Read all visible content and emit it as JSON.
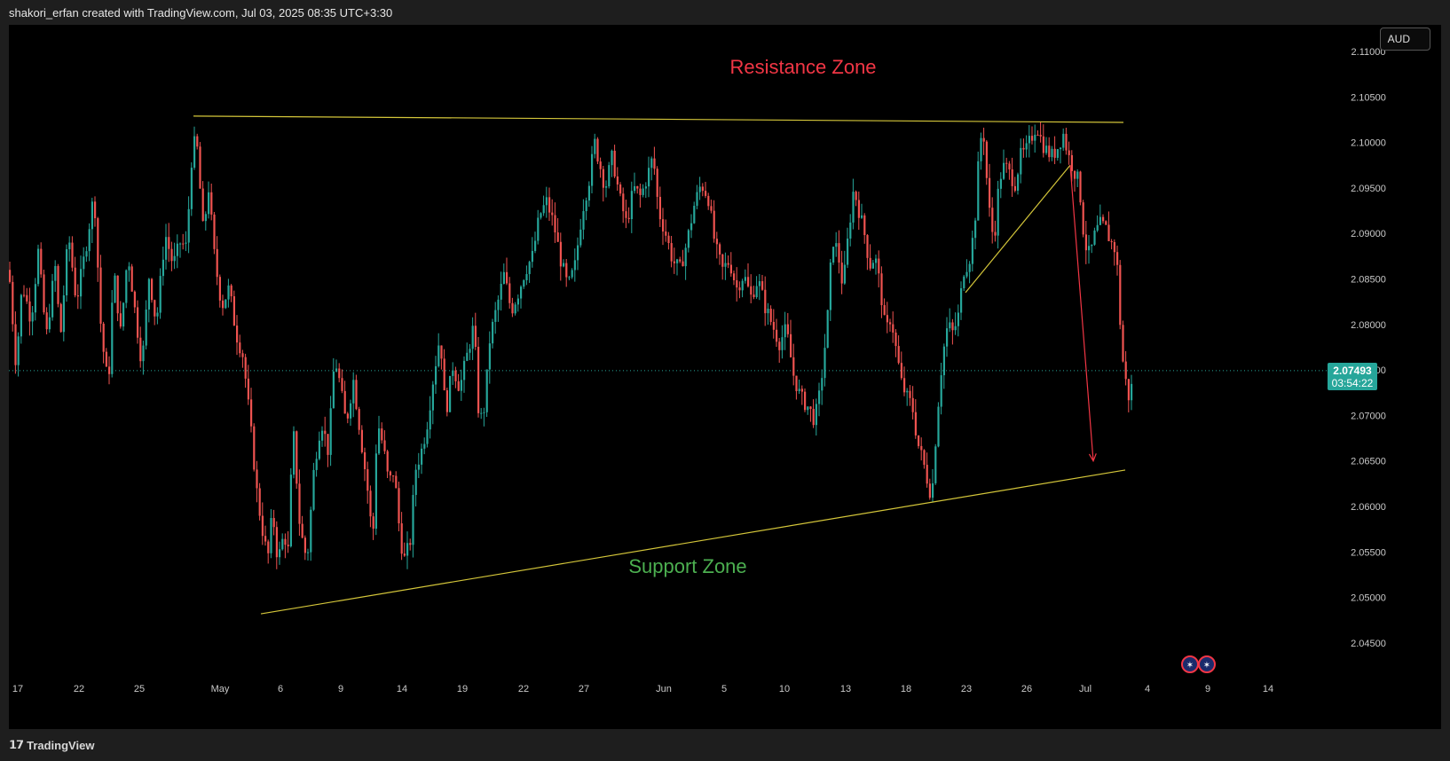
{
  "header": {
    "attribution": "shakori_erfan created with TradingView.com, Jul 03, 2025 08:35 UTC+3:30"
  },
  "footer": {
    "brand": "TradingView",
    "brand_icon": "tradingview-logo-icon"
  },
  "currency_button": "AUD",
  "colors": {
    "background": "#000000",
    "up_candle": "#26a69a",
    "down_candle": "#ef5350",
    "trendline": "#d4c63a",
    "arrow": "#f23645",
    "resistance_text": "#f23645",
    "support_text": "#4caf50",
    "price_tag": "#26a69a"
  },
  "chart_data": {
    "type": "candlestick",
    "instrument_quote": "AUD",
    "y_ticks": [
      "2.11000",
      "2.10500",
      "2.10000",
      "2.09500",
      "2.09000",
      "2.08500",
      "2.08000",
      "2.07500",
      "2.07000",
      "2.06500",
      "2.06000",
      "2.05500",
      "2.05000",
      "2.04500"
    ],
    "ylim": [
      2.0418,
      2.1143
    ],
    "x_ticks": [
      "17",
      "22",
      "25",
      "May",
      "6",
      "9",
      "14",
      "19",
      "22",
      "27",
      "Jun",
      "5",
      "10",
      "13",
      "18",
      "23",
      "26",
      "Jul",
      "4",
      "9",
      "14"
    ],
    "current_price": "2.07493",
    "countdown": "03:54:22",
    "annotations": {
      "resistance_label": "Resistance Zone",
      "support_label": "Support Zone"
    },
    "price_path": [
      [
        0,
        2.086
      ],
      [
        8,
        2.0755
      ],
      [
        15,
        2.0845
      ],
      [
        25,
        2.0805
      ],
      [
        33,
        2.088
      ],
      [
        42,
        2.0785
      ],
      [
        52,
        2.0865
      ],
      [
        58,
        2.0785
      ],
      [
        67,
        2.09
      ],
      [
        76,
        2.0825
      ],
      [
        86,
        2.088
      ],
      [
        96,
        2.0945
      ],
      [
        104,
        2.079
      ],
      [
        112,
        2.073
      ],
      [
        118,
        2.086
      ],
      [
        126,
        2.079
      ],
      [
        134,
        2.088
      ],
      [
        142,
        2.0815
      ],
      [
        150,
        2.0755
      ],
      [
        158,
        2.0855
      ],
      [
        166,
        2.08
      ],
      [
        176,
        2.09
      ],
      [
        185,
        2.0865
      ],
      [
        193,
        2.089
      ],
      [
        200,
        2.0885
      ],
      [
        207,
        2.1
      ],
      [
        212,
        2.0995
      ],
      [
        219,
        2.09
      ],
      [
        225,
        2.095
      ],
      [
        232,
        2.087
      ],
      [
        240,
        2.082
      ],
      [
        248,
        2.084
      ],
      [
        256,
        2.079
      ],
      [
        264,
        2.0765
      ],
      [
        272,
        2.069
      ],
      [
        280,
        2.061
      ],
      [
        288,
        2.056
      ],
      [
        292,
        2.0545
      ],
      [
        297,
        2.0595
      ],
      [
        303,
        2.054
      ],
      [
        310,
        2.057
      ],
      [
        315,
        2.055
      ],
      [
        320,
        2.069
      ],
      [
        328,
        2.0575
      ],
      [
        336,
        2.054
      ],
      [
        344,
        2.0645
      ],
      [
        352,
        2.0695
      ],
      [
        360,
        2.066
      ],
      [
        367,
        2.0765
      ],
      [
        372,
        2.074
      ],
      [
        380,
        2.069
      ],
      [
        388,
        2.074
      ],
      [
        396,
        2.068
      ],
      [
        404,
        2.062
      ],
      [
        410,
        2.056
      ],
      [
        415,
        2.0695
      ],
      [
        422,
        2.0665
      ],
      [
        428,
        2.0625
      ],
      [
        434,
        2.064
      ],
      [
        440,
        2.0575
      ],
      [
        445,
        2.054
      ],
      [
        452,
        2.056
      ],
      [
        458,
        2.064
      ],
      [
        466,
        2.0665
      ],
      [
        472,
        2.0695
      ],
      [
        478,
        2.074
      ],
      [
        486,
        2.079
      ],
      [
        492,
        2.07
      ],
      [
        500,
        2.0755
      ],
      [
        508,
        2.073
      ],
      [
        516,
        2.0765
      ],
      [
        524,
        2.08
      ],
      [
        530,
        2.069
      ],
      [
        536,
        2.071
      ],
      [
        542,
        2.0785
      ],
      [
        550,
        2.082
      ],
      [
        558,
        2.0855
      ],
      [
        566,
        2.0815
      ],
      [
        574,
        2.0835
      ],
      [
        582,
        2.086
      ],
      [
        590,
        2.0875
      ],
      [
        598,
        2.092
      ],
      [
        606,
        2.0935
      ],
      [
        614,
        2.091
      ],
      [
        622,
        2.087
      ],
      [
        630,
        2.084
      ],
      [
        638,
        2.0865
      ],
      [
        646,
        2.0925
      ],
      [
        654,
        2.096
      ],
      [
        660,
        2.1
      ],
      [
        666,
        2.0975
      ],
      [
        672,
        2.095
      ],
      [
        680,
        2.0985
      ],
      [
        688,
        2.094
      ],
      [
        696,
        2.091
      ],
      [
        704,
        2.095
      ],
      [
        712,
        2.094
      ],
      [
        720,
        2.0965
      ],
      [
        726,
        2.0985
      ],
      [
        732,
        2.0925
      ],
      [
        740,
        2.09
      ],
      [
        748,
        2.087
      ],
      [
        756,
        2.086
      ],
      [
        764,
        2.089
      ],
      [
        772,
        2.093
      ],
      [
        780,
        2.0955
      ],
      [
        788,
        2.094
      ],
      [
        796,
        2.0885
      ],
      [
        804,
        2.086
      ],
      [
        812,
        2.087
      ],
      [
        820,
        2.084
      ],
      [
        828,
        2.0855
      ],
      [
        836,
        2.083
      ],
      [
        844,
        2.085
      ],
      [
        852,
        2.082
      ],
      [
        860,
        2.08
      ],
      [
        868,
        2.078
      ],
      [
        876,
        2.0795
      ],
      [
        884,
        2.0745
      ],
      [
        892,
        2.072
      ],
      [
        900,
        2.071
      ],
      [
        908,
        2.0695
      ],
      [
        914,
        2.0725
      ],
      [
        922,
        2.08
      ],
      [
        928,
        2.0895
      ],
      [
        934,
        2.088
      ],
      [
        940,
        2.084
      ],
      [
        946,
        2.09
      ],
      [
        952,
        2.095
      ],
      [
        958,
        2.0925
      ],
      [
        964,
        2.09
      ],
      [
        970,
        2.0865
      ],
      [
        976,
        2.0875
      ],
      [
        982,
        2.084
      ],
      [
        988,
        2.079
      ],
      [
        994,
        2.081
      ],
      [
        1000,
        2.077
      ],
      [
        1006,
        2.0735
      ],
      [
        1012,
        2.072
      ],
      [
        1018,
        2.071
      ],
      [
        1024,
        2.067
      ],
      [
        1030,
        2.065
      ],
      [
        1036,
        2.0625
      ],
      [
        1040,
        2.061
      ],
      [
        1046,
        2.07
      ],
      [
        1052,
        2.0765
      ],
      [
        1058,
        2.08
      ],
      [
        1064,
        2.079
      ],
      [
        1070,
        2.081
      ],
      [
        1076,
        2.086
      ],
      [
        1082,
        2.087
      ],
      [
        1088,
        2.0905
      ],
      [
        1094,
        2.1
      ],
      [
        1098,
        2.1015
      ],
      [
        1104,
        2.093
      ],
      [
        1110,
        2.089
      ],
      [
        1116,
        2.096
      ],
      [
        1122,
        2.0975
      ],
      [
        1128,
        2.0965
      ],
      [
        1134,
        2.0955
      ],
      [
        1140,
        2.0985
      ],
      [
        1146,
        2.099
      ],
      [
        1152,
        2.1005
      ],
      [
        1158,
        2.102
      ],
      [
        1164,
        2.1
      ],
      [
        1170,
        2.099
      ],
      [
        1176,
        2.0985
      ],
      [
        1182,
        2.0995
      ],
      [
        1188,
        2.101
      ],
      [
        1194,
        2.0985
      ],
      [
        1200,
        2.097
      ],
      [
        1206,
        2.0955
      ],
      [
        1212,
        2.089
      ],
      [
        1218,
        2.0875
      ],
      [
        1224,
        2.09
      ],
      [
        1230,
        2.091
      ],
      [
        1236,
        2.0905
      ],
      [
        1242,
        2.089
      ],
      [
        1248,
        2.088
      ],
      [
        1254,
        2.077
      ],
      [
        1258,
        2.074
      ],
      [
        1262,
        2.072
      ],
      [
        1266,
        2.0735
      ],
      [
        1270,
        2.0748
      ]
    ],
    "lines": [
      {
        "name": "resistance",
        "from": [
          208,
          2.1029
        ],
        "to": [
          1256,
          2.1022
        ]
      },
      {
        "name": "support",
        "from": [
          284,
          2.0482
        ],
        "to": [
          1258,
          2.064
        ]
      },
      {
        "name": "rising-wedge",
        "from": [
          1078,
          2.0835
        ],
        "to": [
          1196,
          2.0975
        ]
      }
    ],
    "arrow": {
      "from": [
        1196,
        2.0975
      ],
      "to": [
        1222,
        2.065
      ]
    }
  }
}
